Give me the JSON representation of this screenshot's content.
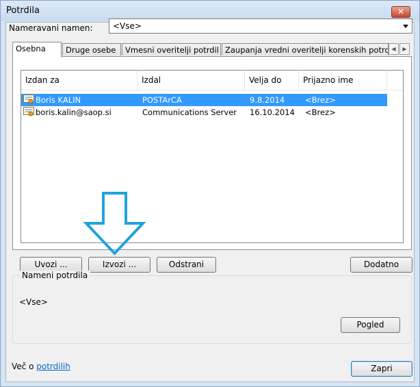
{
  "window": {
    "title": "Potrdila",
    "close_glyph": "✕"
  },
  "purpose": {
    "label": "Nameravani namen:",
    "value": "<Vse>"
  },
  "tabs": [
    {
      "label": "Osebna",
      "active": true
    },
    {
      "label": "Druge osebe",
      "active": false
    },
    {
      "label": "Vmesni overitelji potrdil",
      "active": false
    },
    {
      "label": "Zaupanja vredni overitelji korenskih potrdil",
      "active": false
    }
  ],
  "tab_scroll": {
    "left_glyph": "◀",
    "right_glyph": "▶"
  },
  "list": {
    "columns": [
      "Izdan za",
      "Izdal",
      "Velja do",
      "Prijazno ime"
    ],
    "rows": [
      {
        "issued_to": "Boris KALIN",
        "issued_by": "POSTArCA",
        "expires": "9.8.2014",
        "friendly": "<Brez>",
        "selected": true,
        "icon": "certificate-icon"
      },
      {
        "issued_to": "boris.kalin@saop.si",
        "issued_by": "Communications Server",
        "expires": "16.10.2014",
        "friendly": "<Brez>",
        "selected": false,
        "icon": "certificate-icon"
      }
    ]
  },
  "buttons": {
    "import": "Uvozi ...",
    "export": "Izvozi ...",
    "remove": "Odstrani",
    "advanced": "Dodatno",
    "view": "Pogled",
    "close": "Zapri"
  },
  "cert_purposes": {
    "label": "Nameni potrdila",
    "value": "<Vse>"
  },
  "more_info": {
    "prefix": "Več o ",
    "link": "potrdilih"
  },
  "annotation": {
    "icon": "down-arrow-icon",
    "color": "#1fa3df"
  }
}
